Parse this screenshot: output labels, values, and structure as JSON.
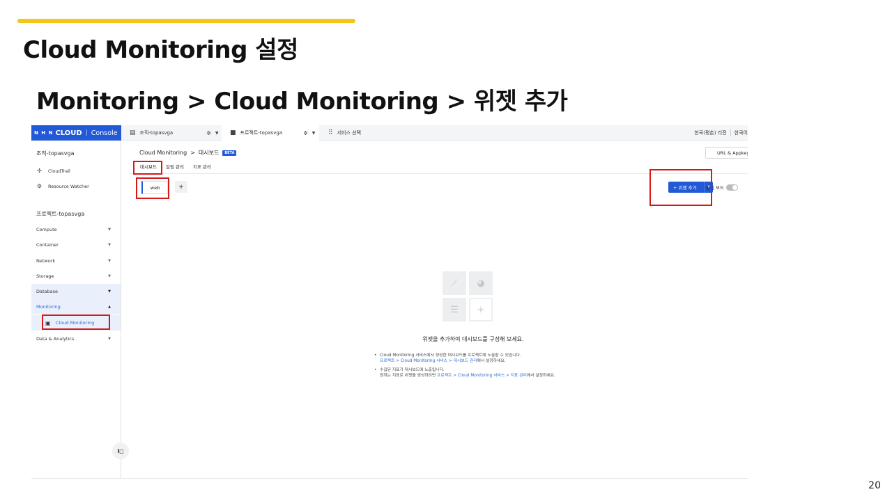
{
  "slide": {
    "title": "Cloud Monitoring 설정",
    "subtitle": "Monitoring > Cloud Monitoring > 위젯 추가",
    "page_number": "20"
  },
  "topbar": {
    "logo_nhn": "N H N",
    "logo_cloud": "CLOUD",
    "logo_separator": "|",
    "logo_console": "Console",
    "org_selector": "조직-topasvga",
    "project_selector": "프로젝트-topasvga",
    "service_select": "서비스 선택",
    "region": "한국(평촌) 리전",
    "language": "한국어"
  },
  "sidebar": {
    "org_name": "조직-topasvga",
    "org_links": [
      "CloudTrail",
      "Resource Watcher"
    ],
    "project_name": "프로젝트-topasvga",
    "menus": [
      "Compute",
      "Container",
      "Network",
      "Storage",
      "Database",
      "Monitoring"
    ],
    "submenu": "Cloud Monitoring",
    "after_menu": "Data & Analytics",
    "collapse_label": "I◻"
  },
  "main": {
    "breadcrumb": [
      "Cloud Monitoring",
      "대시보드"
    ],
    "breadcrumb_separator": ">",
    "beta_badge": "BETA",
    "url_button": "URL & Appkey",
    "tabs": [
      "대시보드",
      "알림 관리",
      "지표 관리"
    ],
    "dashboard_tab": "web",
    "add_tab": "+",
    "add_widget_button": "+ 위젯 추가",
    "edit_mode_label": "편집 모드"
  },
  "empty_state": {
    "title": "위젯을 추가하여 대시보드를 구성해 보세요.",
    "note1_line1": "Cloud Monitoring 서비스에서 생성한 대시보드를 프로젝트에 노출할 수 있습니다.",
    "note1_link": "프로젝트 > Cloud Monitoring 서비스 > 대시보드 관리",
    "note1_suffix": "에서 설정하세요.",
    "note2_line1": "수집된 지표가 대시보드에 노출됩니다.",
    "note2_prefix": "원하는 지표로 위젯을 생성하려면 ",
    "note2_link": "프로젝트 > Cloud Monitoring 서비스 > 지표 관리",
    "note2_suffix": "에서 설정하세요."
  },
  "colors": {
    "accent": "#2159d6",
    "highlight_box": "#d71818",
    "slide_bar": "#f5c518",
    "sidebar_selected": "#e9f0fc"
  },
  "icons": [
    "building-icon",
    "folder-icon",
    "grid-icon",
    "gear-icon",
    "cloudtrail-icon",
    "resource-watcher-icon",
    "cloud-monitoring-icon",
    "line-chart-icon",
    "pie-chart-icon",
    "bar-chart-icon",
    "plus-icon"
  ]
}
